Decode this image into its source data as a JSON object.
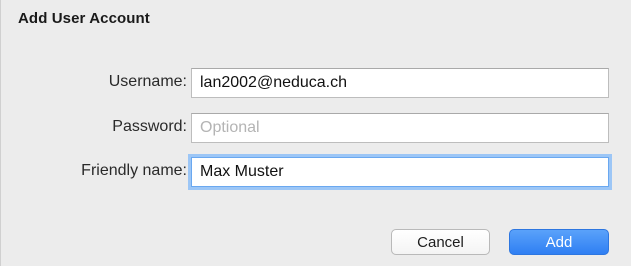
{
  "dialog": {
    "title": "Add User Account"
  },
  "form": {
    "username": {
      "label": "Username:",
      "value": "lan2002@neduca.ch"
    },
    "password": {
      "label": "Password:",
      "placeholder": "Optional",
      "value": ""
    },
    "friendly_name": {
      "label": "Friendly name:",
      "value": "Max Muster"
    }
  },
  "buttons": {
    "cancel_label": "Cancel",
    "add_label": "Add"
  },
  "colors": {
    "accent": "#2f7ff3",
    "focus_ring": "#9cc6f6",
    "dialog_background": "#ececec"
  }
}
